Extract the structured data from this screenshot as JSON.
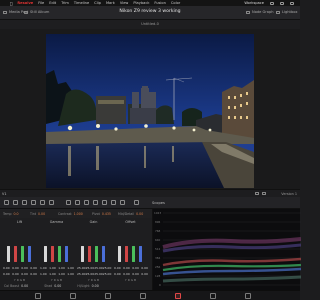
{
  "menubar": {
    "app_name": "Resolve",
    "items": [
      "File",
      "Edit",
      "Trim",
      "Timeline",
      "Clip",
      "Mark",
      "View",
      "Playback",
      "Fusion",
      "Color",
      "Fairlight",
      "Workspace",
      "Help"
    ],
    "workspace_label": "Workspace"
  },
  "toolbar": {
    "title": "Nikon Z9 review 3 working",
    "left_items": [
      "Media Pool",
      "Still Album"
    ],
    "right_items": [
      "Node Graph",
      "Lightbox"
    ]
  },
  "viewer": {
    "clip_name": "Untitled-0",
    "zoom": "100%"
  },
  "clip_strip": {
    "clip_label": "V1",
    "right_label": "Version 1"
  },
  "color_panel": {
    "scopes_title": "Scopes",
    "params": [
      {
        "label": "Temp",
        "value": "0.0"
      },
      {
        "label": "Tint",
        "value": "0.00"
      },
      {
        "label": "Contrast",
        "value": "1.000"
      },
      {
        "label": "Pivot",
        "value": "0.435"
      },
      {
        "label": "Mid/Detail",
        "value": "0.00"
      }
    ],
    "wheels": [
      {
        "name": "Lift",
        "values": [
          "0.00",
          "0.00",
          "0.00",
          "0.00"
        ],
        "values2": [
          "0.00",
          "0.00",
          "0.00",
          "0.00"
        ],
        "sub": "Y R G B"
      },
      {
        "name": "Gamma",
        "values": [
          "1.00",
          "1.00",
          "1.00",
          "1.00"
        ],
        "values2": [
          "1.00",
          "1.00",
          "1.00",
          "1.00"
        ],
        "sub": "Y R G B"
      },
      {
        "name": "Gain",
        "values": [
          "25.00",
          "25.00",
          "25.00",
          "25.00"
        ],
        "values2": [
          "25.00",
          "25.00",
          "25.00",
          "25.00"
        ],
        "sub": "Y R G B"
      },
      {
        "name": "Offset",
        "values": [
          "0.00",
          "0.00",
          "0.00",
          "0.00"
        ],
        "values2": [
          "0.00",
          "0.00",
          "0.00",
          "0.00"
        ],
        "sub": "Y R G B"
      }
    ],
    "footer": [
      {
        "label": "Col Boost",
        "value": "0.00"
      },
      {
        "label": "Shad",
        "value": "0.00"
      },
      {
        "label": "Hi/Light",
        "value": "0.00"
      }
    ]
  },
  "scope": {
    "scale": [
      "1023",
      "896",
      "768",
      "640",
      "512",
      "384",
      "256",
      "128",
      "0"
    ]
  },
  "colors": {
    "accent": "#e23333",
    "param_value": "#d77d4a",
    "bar_y": "#d8d8d8",
    "bar_r": "#d04646",
    "bar_g": "#4bbf5b",
    "bar_b": "#4b6fd8"
  },
  "icons": [
    "apple-icon",
    "media-pool-icon",
    "still-album-icon",
    "node-graph-icon",
    "lightbox-icon",
    "color-page-icon",
    "fairlight-page-icon",
    "deliver-page-icon"
  ]
}
